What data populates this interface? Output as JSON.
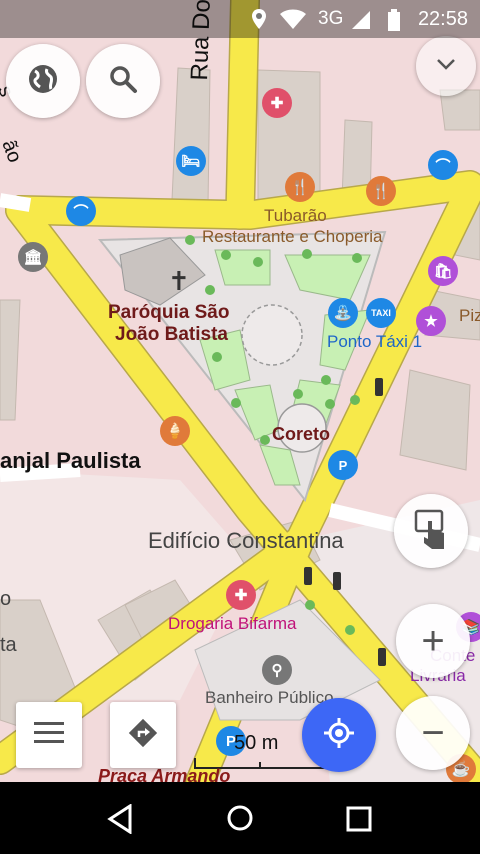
{
  "status_bar": {
    "time": "22:58",
    "network": "3G"
  },
  "map": {
    "streets": {
      "rua_doutor": "Rua Douto"
    },
    "labels": {
      "tubarao_line1": "Tubarão",
      "tubarao_line2": "Restaurante e Choperia",
      "paroquia_line1": "Paróquia São",
      "paroquia_line2": "João Batista",
      "ponto_taxi": "Ponto Táxi 1",
      "coreto": "Coreto",
      "place_left": "anjal Paulista",
      "edificio": "Edifício Constantina",
      "drogaria": "Drogaria Bifarma",
      "banheiro": "Banheiro Público",
      "praca": "Praça Armando",
      "pi_cut": "Piz",
      "conte_cut": "Conte",
      "livraria_cut": "Livraria",
      "ta_cut": "ta",
      "o_cut": "o",
      "s_cut": "s",
      "ao_cut": "ão",
      "taxi_badge": "TAXI"
    },
    "scale": {
      "label": "50 m"
    }
  },
  "controls": {
    "layers_icon": "globe-icon",
    "search_icon": "search-icon",
    "collapse_icon": "chevron-down-icon",
    "touch_icon": "touch-hand-icon",
    "zoom_in": "+",
    "zoom_out": "−",
    "menu_icon": "menu-icon",
    "directions_icon": "directions-icon",
    "location_icon": "my-location-icon"
  },
  "colors": {
    "road_primary": "#f7e94a",
    "residential": "#f2dadb",
    "park": "#c8f0b4",
    "building": "#d9d0c9",
    "location_button": "#3d67f6"
  }
}
